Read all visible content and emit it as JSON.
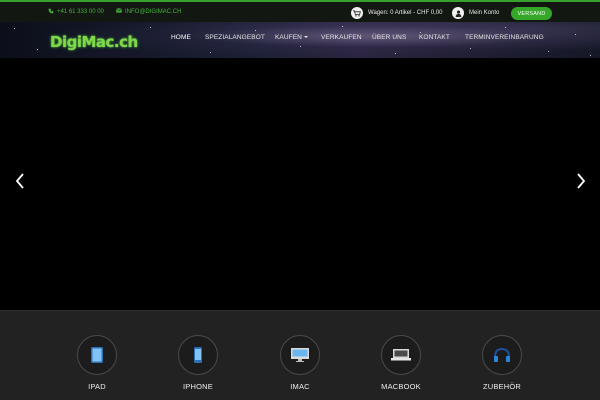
{
  "topbar": {
    "phone": "+41 61 333 00 00",
    "email": "INFO@DIGIMAC.CH",
    "cart_text": "Wagen: 0 Artikel - CHF 0,00",
    "account_label": "Mein Konto",
    "versand_label": "VERSAND",
    "accent_color": "#38a12d"
  },
  "header": {
    "logo_text": "DigiMac.ch",
    "nav": [
      {
        "label": "HOME",
        "active": true
      },
      {
        "label": "SPEZIALANGEBOT"
      },
      {
        "label": "KAUFEN",
        "dropdown": true
      },
      {
        "label": "VERKAUFEN"
      },
      {
        "label": "ÜBER UNS"
      },
      {
        "label": "KONTAKT"
      },
      {
        "label": "TERMINVEREINBARUNG"
      }
    ]
  },
  "slider": {
    "prev_icon": "chevron-left-icon",
    "next_icon": "chevron-right-icon"
  },
  "categories": [
    {
      "label": "IPAD",
      "icon": "ipad-icon"
    },
    {
      "label": "IPHONE",
      "icon": "iphone-icon"
    },
    {
      "label": "IMAC",
      "icon": "imac-icon"
    },
    {
      "label": "MACBOOK",
      "icon": "macbook-icon"
    },
    {
      "label": "ZUBEHÖR",
      "icon": "headphones-icon"
    }
  ]
}
